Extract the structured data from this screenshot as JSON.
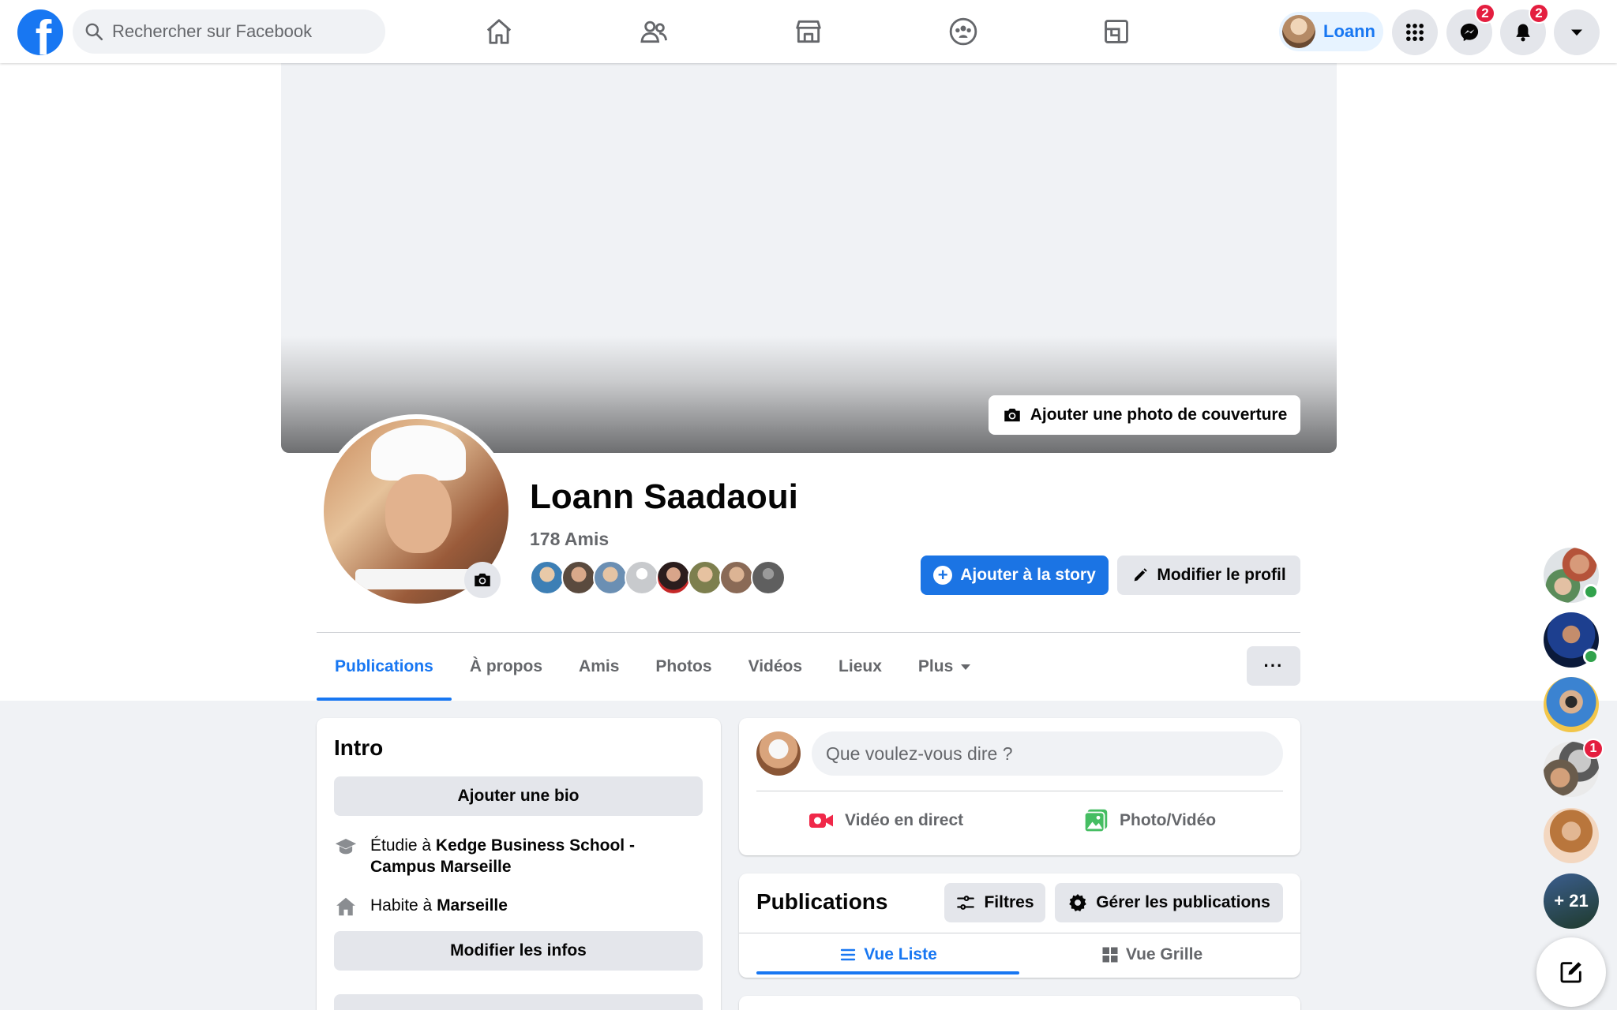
{
  "topbar": {
    "search_placeholder": "Rechercher sur Facebook",
    "nav_icons": [
      "home-icon",
      "friends-icon",
      "marketplace-icon",
      "groups-icon",
      "gaming-icon"
    ],
    "profile_name": "Loann",
    "messenger_badge": "2",
    "notifications_badge": "2",
    "brand_color": "#1877f2"
  },
  "cover": {
    "add_cover_label": "Ajouter une photo de couverture"
  },
  "profile": {
    "name": "Loann Saadaoui",
    "friends_count": "178 Amis",
    "add_story_label": "Ajouter à la story",
    "edit_profile_label": "Modifier le profil"
  },
  "tabs": {
    "items": [
      "Publications",
      "À propos",
      "Amis",
      "Photos",
      "Vidéos",
      "Lieux",
      "Plus"
    ],
    "more_label": "···"
  },
  "intro": {
    "title": "Intro",
    "add_bio_label": "Ajouter une bio",
    "study_prefix": "Étudie à ",
    "study_place": "Kedge Business School - Campus Marseille",
    "lives_prefix": "Habite à ",
    "lives_place": "Marseille",
    "edit_info_label": "Modifier les infos"
  },
  "composer": {
    "placeholder": "Que voulez-vous dire ?",
    "live_label": "Vidéo en direct",
    "photo_label": "Photo/Vidéo"
  },
  "publications": {
    "title": "Publications",
    "filters_label": "Filtres",
    "manage_label": "Gérer les publications",
    "list_view_label": "Vue Liste",
    "grid_view_label": "Vue Grille"
  },
  "contacts": {
    "unread_badge": "1",
    "more_count": "+ 21"
  }
}
